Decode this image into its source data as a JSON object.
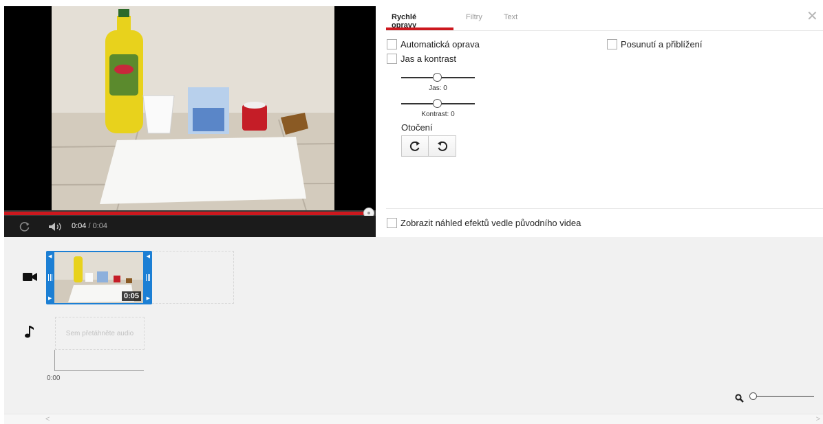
{
  "player": {
    "current_time": "0:04",
    "duration_text": " / 0:04",
    "progress": 1.0,
    "accent_color": "#cc181e"
  },
  "panel": {
    "tabs": [
      {
        "label": "Rychlé opravy",
        "active": true
      },
      {
        "label": "Filtry",
        "active": false
      },
      {
        "label": "Text",
        "active": false
      }
    ],
    "close_icon": "close-icon",
    "auto_fix_label": "Automatická oprava",
    "pan_zoom_label": "Posunutí a přiblížení",
    "brightness_contrast_label": "Jas a kontrast",
    "brightness": {
      "label": "Jas: 0",
      "value": 0
    },
    "contrast": {
      "label": "Kontrast: 0",
      "value": 0
    },
    "rotate_label": "Otočení",
    "rotate_buttons": [
      "rotate-right-icon",
      "rotate-left-icon"
    ],
    "preview_side_by_side_label": "Zobrazit náhled efektů vedle původního videa"
  },
  "timeline": {
    "clip_duration": "0:05",
    "audio_placeholder": "Sem přetáhněte audio",
    "ruler_start": "0:00",
    "video_track_icon": "video-camera-icon",
    "audio_track_icon": "music-note-icon",
    "zoom_icon": "search-icon",
    "zoom_level": 0
  }
}
